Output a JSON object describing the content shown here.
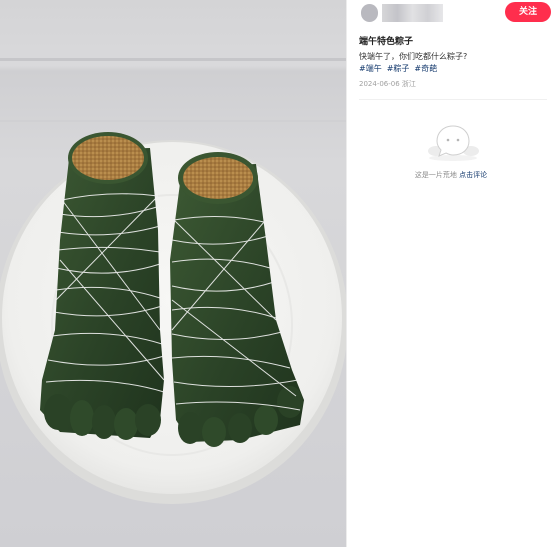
{
  "author": {
    "avatar_icon": "blurred-avatar",
    "name_blocks": [
      "#b9b9bf",
      "#d6d6d8",
      "#c4c4c9",
      "#e1e1e3",
      "#d0d0d4",
      "#e7e7e9"
    ]
  },
  "actions": {
    "follow_label": "关注",
    "follow_color": "#ff2e4d"
  },
  "post": {
    "title": "端午特色粽子",
    "body": "快端午了，你们吃都什么粽子?",
    "tags": [
      "#端午",
      "#粽子",
      "#奇葩"
    ],
    "meta": "2024-06-06 浙江"
  },
  "comments": {
    "empty_icon": "speech-bubble-face-icon",
    "empty_text": "这是一片荒地",
    "comment_link": "点击评论"
  },
  "colors": {
    "tag": "#13386c",
    "leaf": "#2f4a2a",
    "rice": "#a67a3e"
  }
}
